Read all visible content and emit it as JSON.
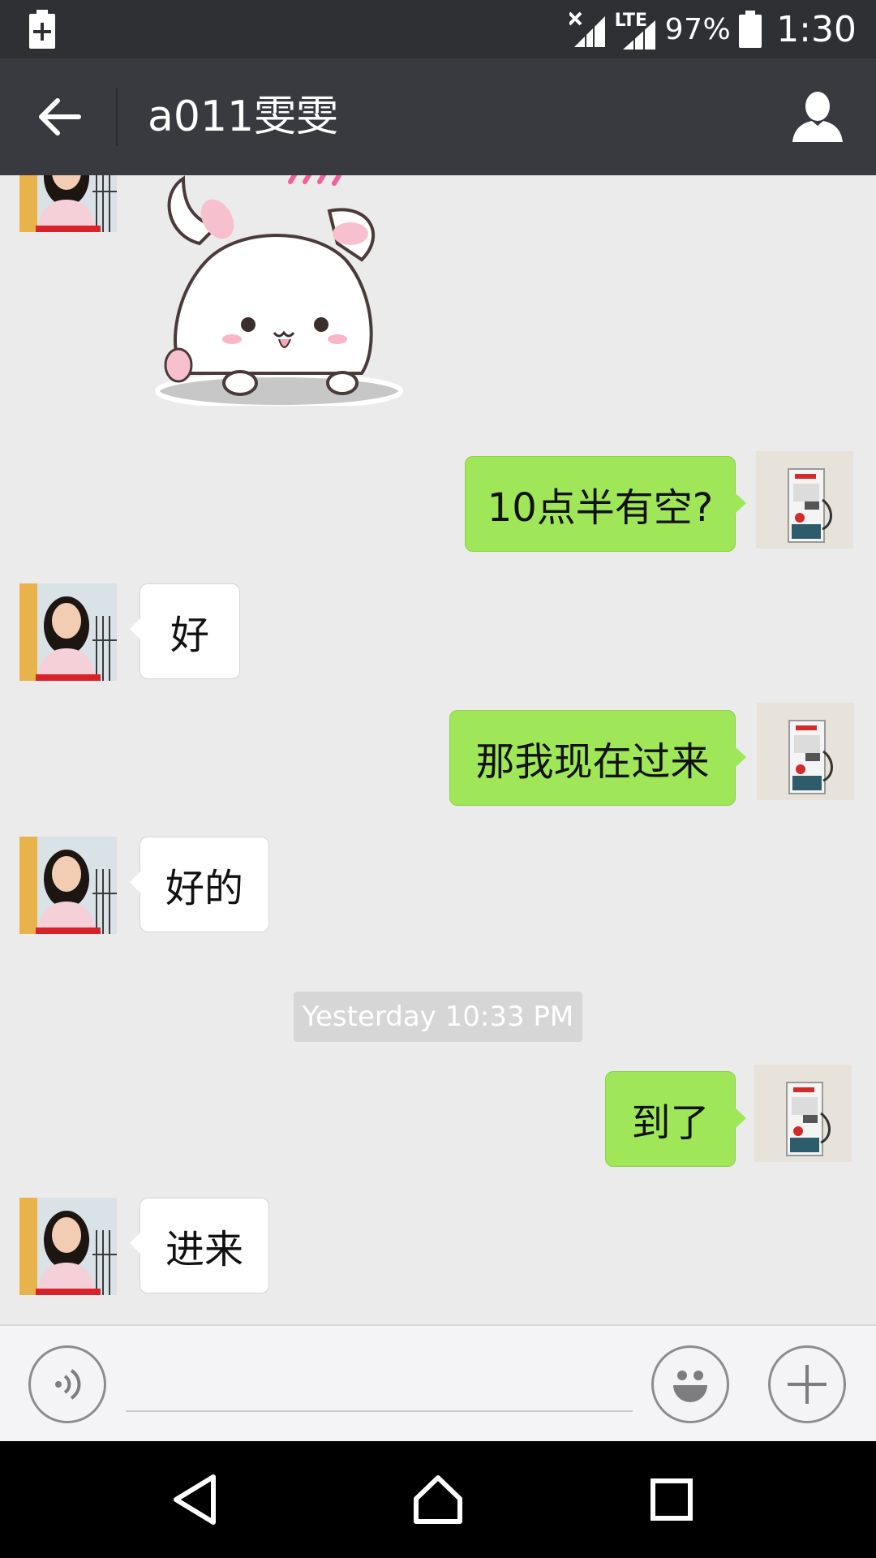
{
  "status_bar": {
    "lte": "LTE",
    "battery_percent": "97%",
    "time": "1:30"
  },
  "header": {
    "title": "a011雯雯",
    "back_icon": "arrow-left-icon",
    "profile_icon": "person-icon"
  },
  "messages": [
    {
      "side": "left",
      "type": "sticker",
      "description_icon": "bunny-sticker"
    },
    {
      "side": "right",
      "type": "text",
      "text": "10点半有空?"
    },
    {
      "side": "left",
      "type": "text",
      "text": "好"
    },
    {
      "side": "right",
      "type": "text",
      "text": "那我现在过来"
    },
    {
      "side": "left",
      "type": "text",
      "text": "好的"
    },
    {
      "side": "center",
      "type": "timestamp",
      "text": "Yesterday 10:33 PM"
    },
    {
      "side": "right",
      "type": "text",
      "text": "到了"
    },
    {
      "side": "left",
      "type": "text",
      "text": "进来"
    }
  ],
  "input_bar": {
    "text_value": "",
    "voice_icon": "voice-icon",
    "emoji_icon": "emoji-icon",
    "plus_icon": "plus-icon"
  },
  "colors": {
    "status_bar": "#2e3034",
    "title_bar": "#393a3f",
    "chat_background": "#ebebeb",
    "sent_bubble": "#9fe658",
    "received_bubble": "#ffffff"
  }
}
